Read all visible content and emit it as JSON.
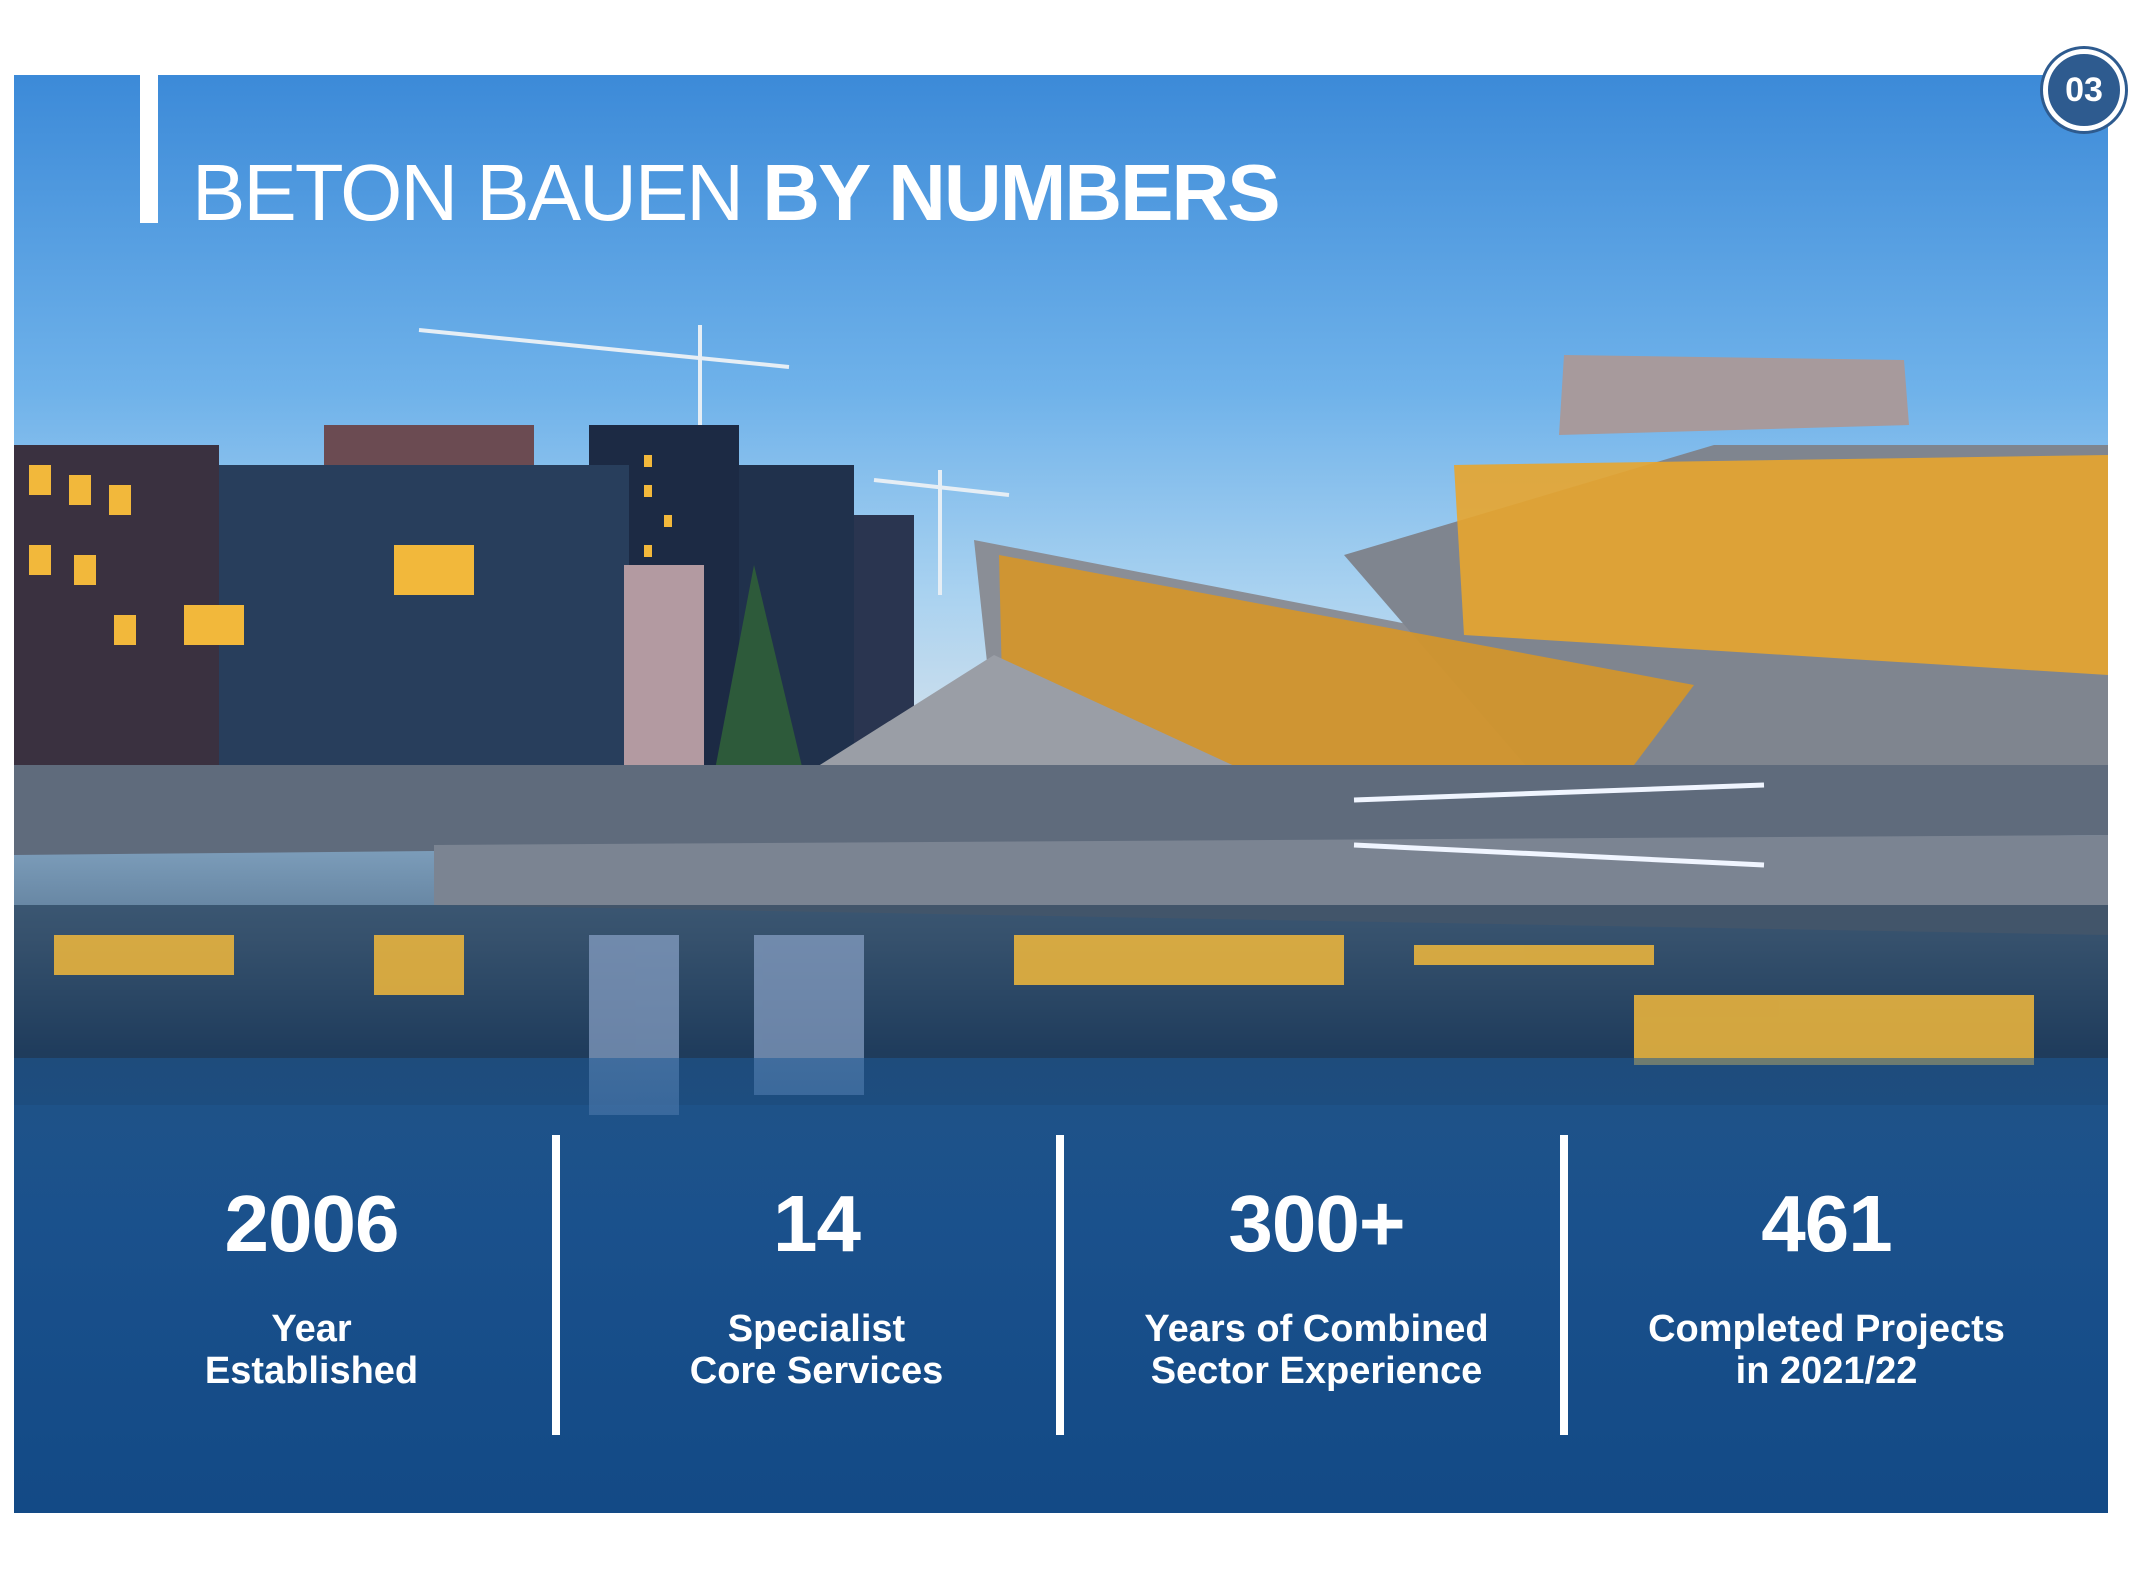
{
  "page_number": "03",
  "title": {
    "light": "BETON BAUEN",
    "bold": "BY NUMBERS"
  },
  "stats": [
    {
      "value": "2006",
      "label_line1": "Year",
      "label_line2": "Established"
    },
    {
      "value": "14",
      "label_line1": "Specialist",
      "label_line2": "Core Services"
    },
    {
      "value": "300+",
      "label_line1": "Years of Combined",
      "label_line2": "Sector Experience"
    },
    {
      "value": "461",
      "label_line1": "Completed Projects",
      "label_line2": "in 2021/22"
    }
  ],
  "colors": {
    "brand_blue": "#2e5b8f",
    "panel_blue": "#134a86",
    "light_gold": "#f5b83a"
  }
}
